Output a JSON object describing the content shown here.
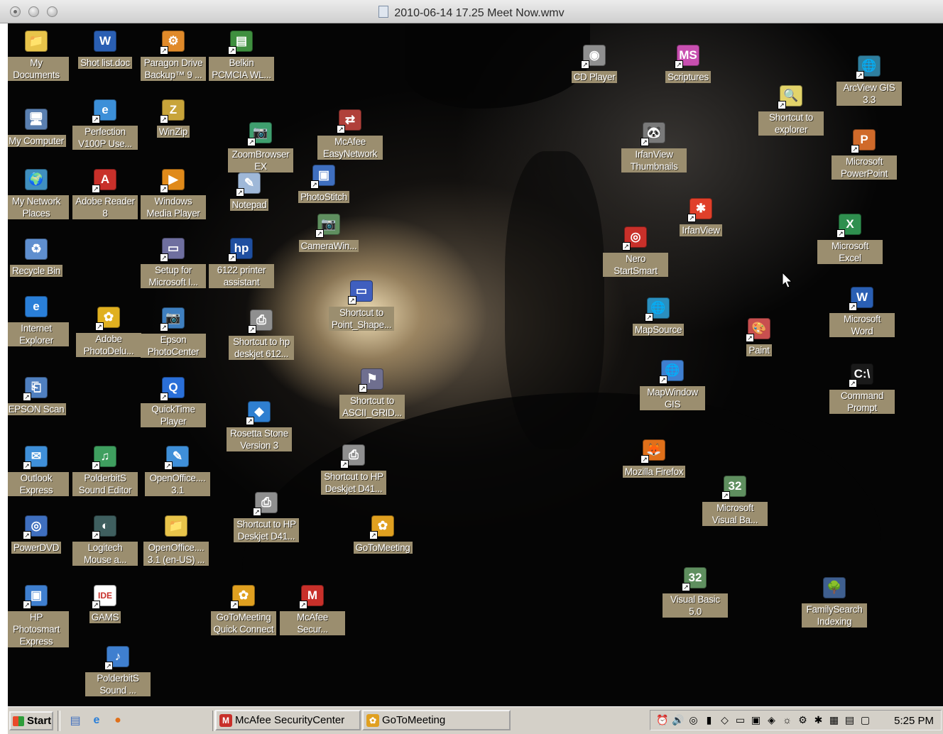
{
  "window": {
    "title": "2010-06-14 17.25 Meet Now.wmv"
  },
  "desktop": {
    "icons": [
      {
        "label": "My Documents",
        "glyph": "📁",
        "color": "#e8c44a",
        "shortcut": false
      },
      {
        "label": "Shot list.doc",
        "glyph": "W",
        "color": "#2a5fb3",
        "shortcut": false
      },
      {
        "label": "Paragon Drive Backup™ 9 ...",
        "glyph": "⚙",
        "color": "#e08a2a",
        "shortcut": true
      },
      {
        "label": "Belkin PCMCIA WL...",
        "glyph": "▤",
        "color": "#3f8f3f",
        "shortcut": true
      },
      {
        "label": "CD Player",
        "glyph": "◉",
        "color": "#8f8f8f",
        "shortcut": true
      },
      {
        "label": "Scriptures",
        "glyph": "MS",
        "color": "#c84fb0",
        "shortcut": true
      },
      {
        "label": "ArcView GIS 3.3",
        "glyph": "🌐",
        "color": "#2f7f9f",
        "shortcut": true
      },
      {
        "label": "Shortcut to explorer",
        "glyph": "🔍",
        "color": "#e2d36a",
        "shortcut": true
      },
      {
        "label": "My Computer",
        "glyph": "🖥",
        "color": "#5a7fb0",
        "shortcut": false
      },
      {
        "label": "Perfection V100P Use...",
        "glyph": "e",
        "color": "#3c8fd8",
        "shortcut": true
      },
      {
        "label": "WinZip",
        "glyph": "Z",
        "color": "#c8a43a",
        "shortcut": true
      },
      {
        "label": "ZoomBrowser EX",
        "glyph": "📷",
        "color": "#3f9f6f",
        "shortcut": true
      },
      {
        "label": "McAfee EasyNetwork",
        "glyph": "⇄",
        "color": "#b0403a",
        "shortcut": true
      },
      {
        "label": "IrfanView Thumbnails",
        "glyph": "🐼",
        "color": "#7a7a7a",
        "shortcut": true
      },
      {
        "label": "Microsoft PowerPoint",
        "glyph": "P",
        "color": "#d06a2a",
        "shortcut": true
      },
      {
        "label": "My Network Places",
        "glyph": "🌍",
        "color": "#3f8fbf",
        "shortcut": false
      },
      {
        "label": "Adobe Reader 8",
        "glyph": "A",
        "color": "#c8302a",
        "shortcut": true
      },
      {
        "label": "Windows Media Player",
        "glyph": "▶",
        "color": "#e08a1a",
        "shortcut": true
      },
      {
        "label": "Notepad",
        "glyph": "✎",
        "color": "#9fb8d8",
        "shortcut": true
      },
      {
        "label": "PhotoStitch",
        "glyph": "▣",
        "color": "#3f6fbf",
        "shortcut": true
      },
      {
        "label": "CameraWin...",
        "glyph": "📷",
        "color": "#5f8f5f",
        "shortcut": true
      },
      {
        "label": "IrfanView",
        "glyph": "✱",
        "color": "#e0402a",
        "shortcut": true
      },
      {
        "label": "Nero StartSmart",
        "glyph": "◎",
        "color": "#c8302a",
        "shortcut": true
      },
      {
        "label": "Microsoft Excel",
        "glyph": "X",
        "color": "#2f8f4f",
        "shortcut": true
      },
      {
        "label": "Recycle Bin",
        "glyph": "♻",
        "color": "#5f8fcf",
        "shortcut": false
      },
      {
        "label": "Setup for Microsoft I...",
        "glyph": "▭",
        "color": "#6f6f9f",
        "shortcut": true
      },
      {
        "label": "6122 printer assistant",
        "glyph": "hp",
        "color": "#1f4fa0",
        "shortcut": true
      },
      {
        "label": "Shortcut to Point_Shape...",
        "glyph": "▭",
        "color": "#3f5fbf",
        "shortcut": true
      },
      {
        "label": "MapSource",
        "glyph": "🌐",
        "color": "#2a8fbf",
        "shortcut": true
      },
      {
        "label": "Microsoft Word",
        "glyph": "W",
        "color": "#2a5fb3",
        "shortcut": true
      },
      {
        "label": "Internet Explorer",
        "glyph": "e",
        "color": "#2a7fd8",
        "shortcut": false
      },
      {
        "label": "Adobe PhotoDelu...",
        "glyph": "✿",
        "color": "#e0b020",
        "shortcut": true
      },
      {
        "label": "Epson PhotoCenter",
        "glyph": "📷",
        "color": "#3f7fbf",
        "shortcut": true
      },
      {
        "label": "Shortcut to hp deskjet 612...",
        "glyph": "⎙",
        "color": "#8f8f8f",
        "shortcut": true
      },
      {
        "label": "Paint",
        "glyph": "🎨",
        "color": "#c84f4f",
        "shortcut": true
      },
      {
        "label": "Command Prompt",
        "glyph": "C:\\",
        "color": "#1a1a1a",
        "shortcut": true
      },
      {
        "label": "EPSON Scan",
        "glyph": "⎗",
        "color": "#4f7fbf",
        "shortcut": true
      },
      {
        "label": "QuickTime Player",
        "glyph": "Q",
        "color": "#2a6fd8",
        "shortcut": true
      },
      {
        "label": "Shortcut to ASCII_GRID...",
        "glyph": "⚑",
        "color": "#6f6f8f",
        "shortcut": true
      },
      {
        "label": "MapWindow GIS",
        "glyph": "🌐",
        "color": "#3f7fcf",
        "shortcut": true
      },
      {
        "label": "Rosetta Stone Version 3",
        "glyph": "◆",
        "color": "#2f7fd0",
        "shortcut": true
      },
      {
        "label": "Outlook Express",
        "glyph": "✉",
        "color": "#3f8fd8",
        "shortcut": true
      },
      {
        "label": "PolderbitS Sound Editor",
        "glyph": "♫",
        "color": "#3f9f5f",
        "shortcut": true
      },
      {
        "label": "OpenOffice.... 3.1",
        "glyph": "✎",
        "color": "#3f8fd8",
        "shortcut": true
      },
      {
        "label": "Shortcut to HP Deskjet D41...",
        "glyph": "⎙",
        "color": "#8f8f8f",
        "shortcut": true
      },
      {
        "label": "Mozilla Firefox",
        "glyph": "🦊",
        "color": "#e0701a",
        "shortcut": true
      },
      {
        "label": "Microsoft Visual Ba...",
        "glyph": "32",
        "color": "#5f8f5f",
        "shortcut": true
      },
      {
        "label": "PowerDVD",
        "glyph": "◎",
        "color": "#3f6fbf",
        "shortcut": true
      },
      {
        "label": "Logitech Mouse a...",
        "glyph": "◐",
        "color": "#3f5f5f",
        "shortcut": true
      },
      {
        "label": "OpenOffice.... 3.1 (en-US) ...",
        "glyph": "📁",
        "color": "#e8c44a",
        "shortcut": false
      },
      {
        "label": "Shortcut to HP Deskjet D41...",
        "glyph": "⎙",
        "color": "#8f8f8f",
        "shortcut": true
      },
      {
        "label": "GoToMeeting",
        "glyph": "✿",
        "color": "#e0a020",
        "shortcut": true
      },
      {
        "label": "HP Photosmart Express",
        "glyph": "▣",
        "color": "#3f7fcf",
        "shortcut": true
      },
      {
        "label": "GAMS",
        "glyph": "IDE",
        "color": "#ffffff",
        "shortcut": true
      },
      {
        "label": "GoToMeeting Quick Connect",
        "glyph": "✿",
        "color": "#e0a020",
        "shortcut": true
      },
      {
        "label": "McAfee Secur...",
        "glyph": "M",
        "color": "#c8302a",
        "shortcut": true
      },
      {
        "label": "Visual Basic 5.0",
        "glyph": "32",
        "color": "#5f8f5f",
        "shortcut": true
      },
      {
        "label": "FamilySearch Indexing",
        "glyph": "🌳",
        "color": "#3f5f8f",
        "shortcut": false
      },
      {
        "label": "PolderbitS Sound ...",
        "glyph": "♪",
        "color": "#3f7fcf",
        "shortcut": true
      }
    ]
  },
  "taskbar": {
    "start_label": "Start",
    "quick_launch": [
      "show-desktop",
      "internet-explorer",
      "firefox"
    ],
    "tasks": [
      {
        "label": "McAfee SecurityCenter",
        "glyph": "M",
        "color": "#c8302a"
      },
      {
        "label": "GoToMeeting",
        "glyph": "✿",
        "color": "#e0a020"
      }
    ],
    "tray_icons": [
      "⏰",
      "🔊",
      "◎",
      "▮",
      "◇",
      "▭",
      "▣",
      "◈",
      "☼",
      "⚙",
      "✱",
      "▦",
      "▤",
      "▢"
    ],
    "clock": "5:25 PM"
  }
}
